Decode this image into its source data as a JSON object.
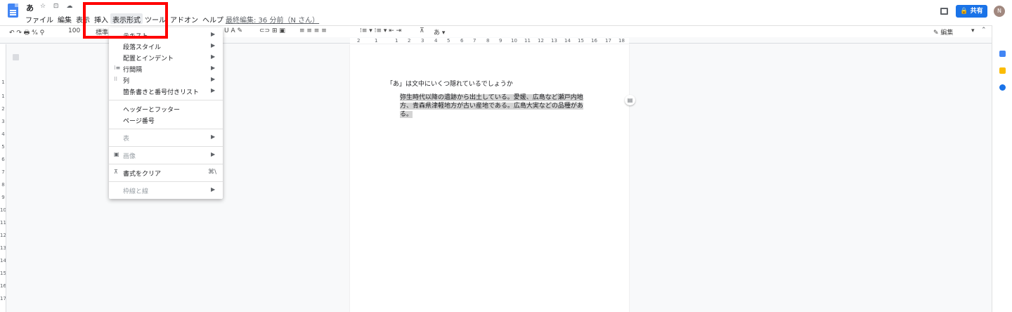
{
  "app": {
    "title": "あ",
    "title_icons": "☆ ⊡ ☁",
    "menus": [
      "ファイル",
      "編集",
      "表示",
      "挿入",
      "表示形式",
      "ツール",
      "アドオン",
      "ヘルプ"
    ],
    "active_menu": "表示形式",
    "last_edit": "最終編集: 36 分前（N さん）",
    "share_label": "🔒 共有",
    "avatar_letter": "N"
  },
  "toolbar": {
    "undo": "↶ ↷ 🖶 ⁴⁄ₐ ⚲",
    "zoom": "100",
    "style": "標準",
    "format_icons": "U A ✎",
    "insert_icons": "⊂⊃ ⊞ ▣",
    "align_icons": "≡ ≡ ≡ ≡",
    "list_icons": "⁝≡ ▾ ⁝≡ ▾ ⇤ ⇥",
    "clear_icon": "⊼",
    "input_mode": "あ ▾",
    "edit_mode": "✎ 編集",
    "edit_mode_arrow": "▾"
  },
  "ruler": {
    "h_ticks": [
      "2",
      "1",
      "1",
      "2",
      "3",
      "4",
      "5",
      "6",
      "7",
      "8",
      "9",
      "10",
      "11",
      "12",
      "13",
      "14",
      "15",
      "16",
      "17",
      "18"
    ],
    "v_ticks": [
      "1",
      "1",
      "2",
      "3",
      "4",
      "5",
      "6",
      "7",
      "8",
      "9",
      "10",
      "11",
      "12",
      "13",
      "14",
      "15",
      "16",
      "17"
    ]
  },
  "document": {
    "heading": "「あ」は文中にいくつ隠れているでしょうか",
    "paragraph_line1": "弥生時代以降の遺跡から出土している。愛媛、広島など瀬戸内地",
    "paragraph_line2": "方、青森県津軽地方が古い産地である。広島大実などの品種があ",
    "paragraph_line3": "る。"
  },
  "format_menu": {
    "items": [
      {
        "label": "テキスト",
        "submenu": true,
        "disabled": false,
        "icon": ""
      },
      {
        "label": "段落スタイル",
        "submenu": true,
        "disabled": false,
        "icon": ""
      },
      {
        "label": "配置とインデント",
        "submenu": true,
        "disabled": false,
        "icon": ""
      },
      {
        "label": "行間隔",
        "submenu": true,
        "disabled": false,
        "icon": "⁝≡"
      },
      {
        "label": "列",
        "submenu": true,
        "disabled": false,
        "icon": "⁝⁝"
      },
      {
        "label": "箇条書きと番号付きリスト",
        "submenu": true,
        "disabled": false,
        "icon": ""
      },
      {
        "label": "ヘッダーとフッター",
        "submenu": false,
        "disabled": false,
        "icon": ""
      },
      {
        "label": "ページ番号",
        "submenu": false,
        "disabled": false,
        "icon": ""
      },
      {
        "label": "表",
        "submenu": true,
        "disabled": true,
        "icon": ""
      },
      {
        "label": "画像",
        "submenu": true,
        "disabled": true,
        "icon": "▣"
      },
      {
        "label": "書式をクリア",
        "submenu": false,
        "disabled": false,
        "icon": "⊼",
        "shortcut": "⌘\\"
      },
      {
        "label": "枠線と線",
        "submenu": true,
        "disabled": true,
        "icon": ""
      }
    ],
    "arrow": "▶"
  },
  "colors": {
    "accent": "#1a73e8",
    "highlight_box": "#ff0000",
    "selection": "#d4d4d4"
  }
}
